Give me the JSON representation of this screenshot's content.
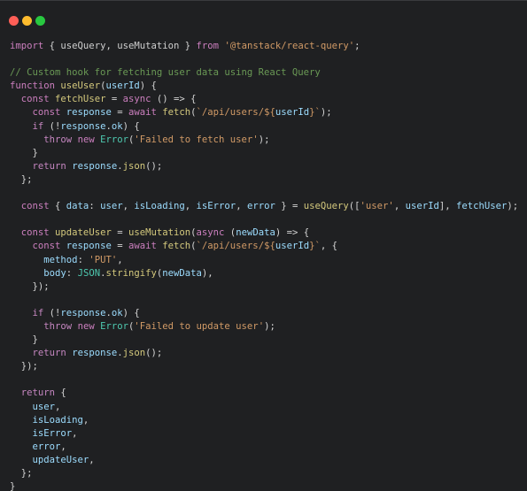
{
  "window": {
    "title_dots": [
      "close",
      "minimize",
      "zoom"
    ],
    "colors": {
      "background": "#1f2022",
      "close": "#ff5f57",
      "minimize": "#febc2e",
      "zoom": "#28c840"
    }
  },
  "code": {
    "language": "javascript",
    "lines": [
      [
        [
          "kw",
          "import"
        ],
        [
          "pun",
          " { "
        ],
        [
          "id",
          "useQuery"
        ],
        [
          "pun",
          ", "
        ],
        [
          "id",
          "useMutation"
        ],
        [
          "pun",
          " } "
        ],
        [
          "kw",
          "from"
        ],
        [
          "pun",
          " "
        ],
        [
          "str",
          "'@tanstack/react-query'"
        ],
        [
          "pun",
          ";"
        ]
      ],
      [],
      [
        [
          "com",
          "// Custom hook for fetching user data using React Query"
        ]
      ],
      [
        [
          "kw",
          "function"
        ],
        [
          "pun",
          " "
        ],
        [
          "fn",
          "useUser"
        ],
        [
          "pun",
          "("
        ],
        [
          "var",
          "userId"
        ],
        [
          "pun",
          ") {"
        ]
      ],
      [
        [
          "pun",
          "  "
        ],
        [
          "kw",
          "const"
        ],
        [
          "pun",
          " "
        ],
        [
          "fn",
          "fetchUser"
        ],
        [
          "pun",
          " = "
        ],
        [
          "kw",
          "async"
        ],
        [
          "pun",
          " () => {"
        ]
      ],
      [
        [
          "pun",
          "    "
        ],
        [
          "kw",
          "const"
        ],
        [
          "pun",
          " "
        ],
        [
          "var",
          "response"
        ],
        [
          "pun",
          " = "
        ],
        [
          "kw",
          "await"
        ],
        [
          "pun",
          " "
        ],
        [
          "fn",
          "fetch"
        ],
        [
          "pun",
          "("
        ],
        [
          "str",
          "`/api/users/${"
        ],
        [
          "var",
          "userId"
        ],
        [
          "str",
          "}`"
        ],
        [
          "pun",
          ");"
        ]
      ],
      [
        [
          "pun",
          "    "
        ],
        [
          "ctl",
          "if"
        ],
        [
          "pun",
          " (!"
        ],
        [
          "var",
          "response"
        ],
        [
          "pun",
          "."
        ],
        [
          "var",
          "ok"
        ],
        [
          "pun",
          ") {"
        ]
      ],
      [
        [
          "pun",
          "      "
        ],
        [
          "ctl",
          "throw"
        ],
        [
          "pun",
          " "
        ],
        [
          "kw",
          "new"
        ],
        [
          "pun",
          " "
        ],
        [
          "type",
          "Error"
        ],
        [
          "pun",
          "("
        ],
        [
          "str",
          "'Failed to fetch user'"
        ],
        [
          "pun",
          ");"
        ]
      ],
      [
        [
          "pun",
          "    }"
        ]
      ],
      [
        [
          "pun",
          "    "
        ],
        [
          "ctl",
          "return"
        ],
        [
          "pun",
          " "
        ],
        [
          "var",
          "response"
        ],
        [
          "pun",
          "."
        ],
        [
          "fn",
          "json"
        ],
        [
          "pun",
          "();"
        ]
      ],
      [
        [
          "pun",
          "  };"
        ]
      ],
      [],
      [
        [
          "pun",
          "  "
        ],
        [
          "kw",
          "const"
        ],
        [
          "pun",
          " { "
        ],
        [
          "var",
          "data"
        ],
        [
          "pun",
          ": "
        ],
        [
          "var",
          "user"
        ],
        [
          "pun",
          ", "
        ],
        [
          "var",
          "isLoading"
        ],
        [
          "pun",
          ", "
        ],
        [
          "var",
          "isError"
        ],
        [
          "pun",
          ", "
        ],
        [
          "var",
          "error"
        ],
        [
          "pun",
          " } = "
        ],
        [
          "fn",
          "useQuery"
        ],
        [
          "pun",
          "(["
        ],
        [
          "str",
          "'user'"
        ],
        [
          "pun",
          ", "
        ],
        [
          "var",
          "userId"
        ],
        [
          "pun",
          "], "
        ],
        [
          "var",
          "fetchUser"
        ],
        [
          "pun",
          ");"
        ]
      ],
      [],
      [
        [
          "pun",
          "  "
        ],
        [
          "kw",
          "const"
        ],
        [
          "pun",
          " "
        ],
        [
          "fn",
          "updateUser"
        ],
        [
          "pun",
          " = "
        ],
        [
          "fn",
          "useMutation"
        ],
        [
          "pun",
          "("
        ],
        [
          "kw",
          "async"
        ],
        [
          "pun",
          " ("
        ],
        [
          "var",
          "newData"
        ],
        [
          "pun",
          ") => {"
        ]
      ],
      [
        [
          "pun",
          "    "
        ],
        [
          "kw",
          "const"
        ],
        [
          "pun",
          " "
        ],
        [
          "var",
          "response"
        ],
        [
          "pun",
          " = "
        ],
        [
          "kw",
          "await"
        ],
        [
          "pun",
          " "
        ],
        [
          "fn",
          "fetch"
        ],
        [
          "pun",
          "("
        ],
        [
          "str",
          "`/api/users/${"
        ],
        [
          "var",
          "userId"
        ],
        [
          "str",
          "}`"
        ],
        [
          "pun",
          ", {"
        ]
      ],
      [
        [
          "pun",
          "      "
        ],
        [
          "var",
          "method"
        ],
        [
          "pun",
          ": "
        ],
        [
          "str",
          "'PUT'"
        ],
        [
          "pun",
          ","
        ]
      ],
      [
        [
          "pun",
          "      "
        ],
        [
          "var",
          "body"
        ],
        [
          "pun",
          ": "
        ],
        [
          "type",
          "JSON"
        ],
        [
          "pun",
          "."
        ],
        [
          "fn",
          "stringify"
        ],
        [
          "pun",
          "("
        ],
        [
          "var",
          "newData"
        ],
        [
          "pun",
          "),"
        ]
      ],
      [
        [
          "pun",
          "    });"
        ]
      ],
      [],
      [
        [
          "pun",
          "    "
        ],
        [
          "ctl",
          "if"
        ],
        [
          "pun",
          " (!"
        ],
        [
          "var",
          "response"
        ],
        [
          "pun",
          "."
        ],
        [
          "var",
          "ok"
        ],
        [
          "pun",
          ") {"
        ]
      ],
      [
        [
          "pun",
          "      "
        ],
        [
          "ctl",
          "throw"
        ],
        [
          "pun",
          " "
        ],
        [
          "kw",
          "new"
        ],
        [
          "pun",
          " "
        ],
        [
          "type",
          "Error"
        ],
        [
          "pun",
          "("
        ],
        [
          "str",
          "'Failed to update user'"
        ],
        [
          "pun",
          ");"
        ]
      ],
      [
        [
          "pun",
          "    }"
        ]
      ],
      [
        [
          "pun",
          "    "
        ],
        [
          "ctl",
          "return"
        ],
        [
          "pun",
          " "
        ],
        [
          "var",
          "response"
        ],
        [
          "pun",
          "."
        ],
        [
          "fn",
          "json"
        ],
        [
          "pun",
          "();"
        ]
      ],
      [
        [
          "pun",
          "  });"
        ]
      ],
      [],
      [
        [
          "pun",
          "  "
        ],
        [
          "ctl",
          "return"
        ],
        [
          "pun",
          " {"
        ]
      ],
      [
        [
          "pun",
          "    "
        ],
        [
          "var",
          "user"
        ],
        [
          "pun",
          ","
        ]
      ],
      [
        [
          "pun",
          "    "
        ],
        [
          "var",
          "isLoading"
        ],
        [
          "pun",
          ","
        ]
      ],
      [
        [
          "pun",
          "    "
        ],
        [
          "var",
          "isError"
        ],
        [
          "pun",
          ","
        ]
      ],
      [
        [
          "pun",
          "    "
        ],
        [
          "var",
          "error"
        ],
        [
          "pun",
          ","
        ]
      ],
      [
        [
          "pun",
          "    "
        ],
        [
          "var",
          "updateUser"
        ],
        [
          "pun",
          ","
        ]
      ],
      [
        [
          "pun",
          "  };"
        ]
      ],
      [
        [
          "pun",
          "}"
        ]
      ]
    ]
  }
}
